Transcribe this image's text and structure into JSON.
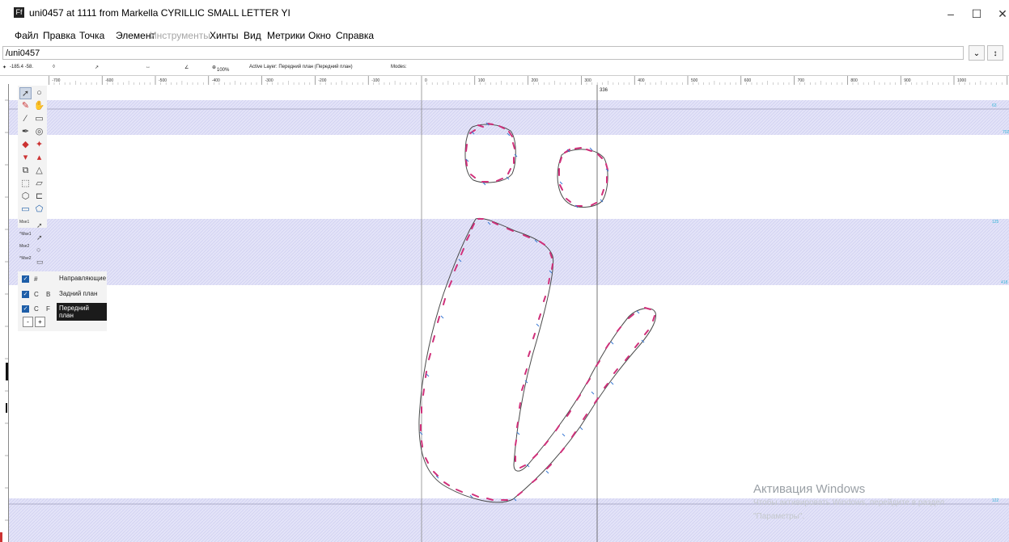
{
  "window": {
    "title": "uni0457 at 1111 from Markella CYRILLIC SMALL LETTER YI",
    "app_icon": "fontforge-icon",
    "controls": {
      "minimize": "–",
      "maximize": "☐",
      "close": "✕"
    }
  },
  "menubar": [
    {
      "label": "Файл",
      "enabled": true
    },
    {
      "label": "Правка",
      "enabled": true
    },
    {
      "label": "Точка",
      "enabled": true
    },
    {
      "label": "Элемент",
      "enabled": true
    },
    {
      "label": "Инструменты",
      "enabled": false
    },
    {
      "label": "Хинты",
      "enabled": true
    },
    {
      "label": "Вид",
      "enabled": true
    },
    {
      "label": "Метрики",
      "enabled": true
    },
    {
      "label": "Окно",
      "enabled": true
    },
    {
      "label": "Справка",
      "enabled": true
    }
  ],
  "path": {
    "value": "/uni0457",
    "btn_down": "⌄",
    "btn_sort": "↕"
  },
  "info": {
    "coords": "-185.4 -58.",
    "zoom": "100%",
    "active_layer": "Active Layer: Передний план (Передний план)",
    "modes": "Modes:"
  },
  "ruler": {
    "h_labels": [
      "-700",
      "-600",
      "-500",
      "-400",
      "-300",
      "-200",
      "-100",
      "0",
      "100",
      "200",
      "300",
      "400",
      "500",
      "600",
      "700",
      "800",
      "900",
      "1000",
      "1100"
    ],
    "cursor_x_label": "336",
    "right_labels": [
      "63",
      "702",
      "125",
      "418",
      "122"
    ]
  },
  "tools": {
    "active": "pointer",
    "mods": [
      "Mse1",
      "^Mse1",
      "Mse2",
      "^Mse2"
    ]
  },
  "layers": [
    {
      "checked": true,
      "c1": "#",
      "c2": "",
      "name": "Направляющие",
      "selected": false
    },
    {
      "checked": true,
      "c1": "C",
      "c2": "B",
      "name": "Задний план",
      "selected": false
    },
    {
      "checked": true,
      "c1": "C",
      "c2": "F",
      "name": "Передний план",
      "selected": true
    }
  ],
  "layer_buttons": {
    "remove": "-",
    "add": "+"
  },
  "watermark": {
    "title": "Активация Windows",
    "line1": "Чтобы активировать Windows, перейдите в раздел",
    "line2": "\"Параметры\"."
  },
  "colors": {
    "band": "#dcdcf6",
    "contour": "#5a5a5a",
    "point_pink": "#d0307a",
    "point_blue": "#3b7bd6",
    "guide": "#707070"
  }
}
